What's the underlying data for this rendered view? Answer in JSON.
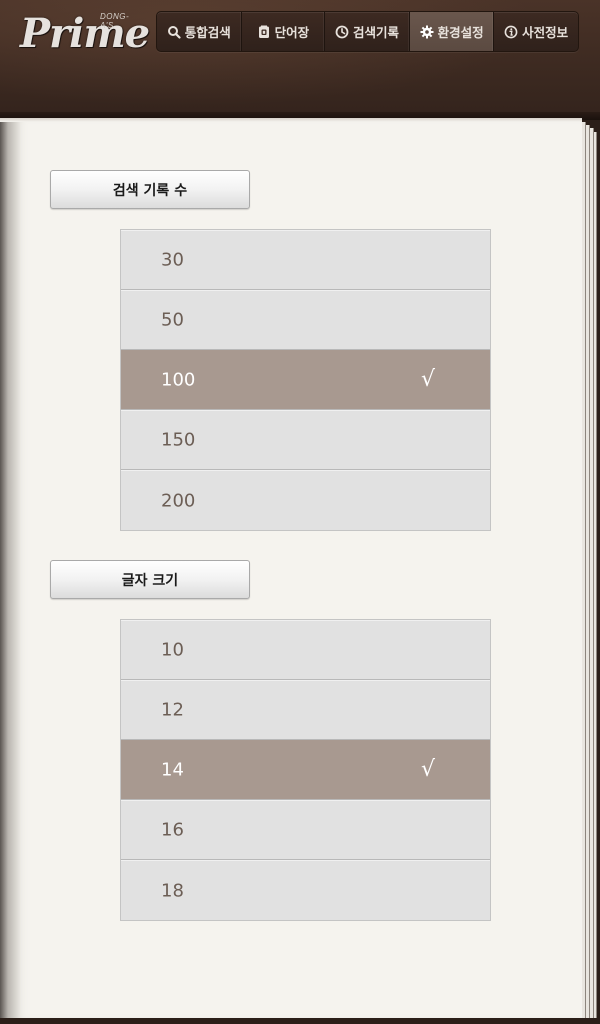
{
  "app": {
    "logo_text": "Prime",
    "logo_sub": "DONG-A'S"
  },
  "nav": {
    "items": [
      {
        "label": "통합검색",
        "icon": "search-icon",
        "active": false
      },
      {
        "label": "단어장",
        "icon": "wordbook-icon",
        "active": false
      },
      {
        "label": "검색기록",
        "icon": "clock-icon",
        "active": false
      },
      {
        "label": "환경설정",
        "icon": "gear-icon",
        "active": true
      },
      {
        "label": "사전정보",
        "icon": "info-icon",
        "active": false
      }
    ]
  },
  "settings": {
    "history_count": {
      "label": "검색 기록 수",
      "options": [
        "30",
        "50",
        "100",
        "150",
        "200"
      ],
      "selected": "100"
    },
    "font_size": {
      "label": "글자 크기",
      "options": [
        "10",
        "12",
        "14",
        "16",
        "18"
      ],
      "selected": "14"
    },
    "check_mark": "√"
  },
  "colors": {
    "header_bg": "#3d2a21",
    "nav_active": "#5b4a41",
    "option_bg": "#e1e1e1",
    "option_selected": "#a89990",
    "option_text": "#6c5e55",
    "page_bg": "#f5f3ee"
  }
}
